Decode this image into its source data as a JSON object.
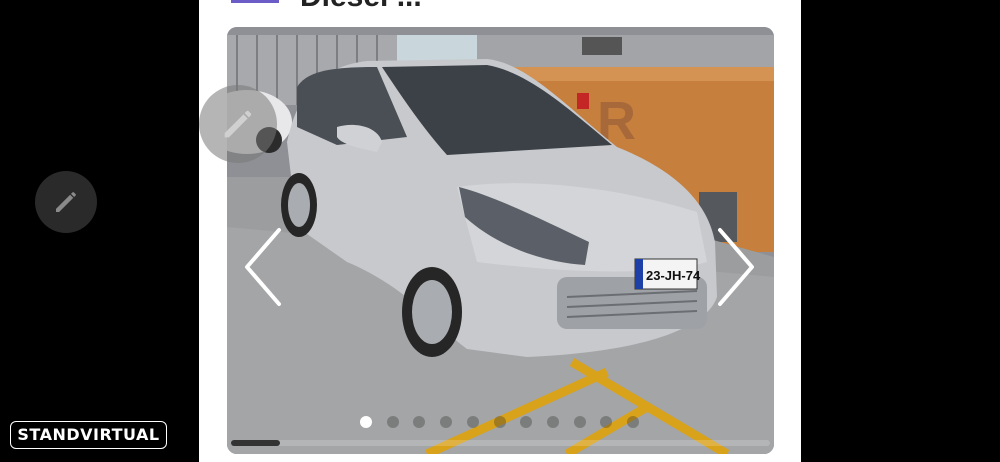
{
  "listing": {
    "title": "Diesel ..."
  },
  "gallery": {
    "image_count": 11,
    "active_index": 0,
    "scroll_progress": 0.09,
    "license_plate": "23-JH-74",
    "background_sign": "R"
  },
  "branding": {
    "logo_text": "STANDVIRTUAL"
  },
  "colors": {
    "page_background": "#000000",
    "card_background": "#ffffff",
    "arrow_color": "#ffffff",
    "fab_dark": "#2a2a2a"
  },
  "icons": {
    "prev": "chevron-left-icon",
    "next": "chevron-right-icon",
    "edit": "pencil-icon"
  }
}
